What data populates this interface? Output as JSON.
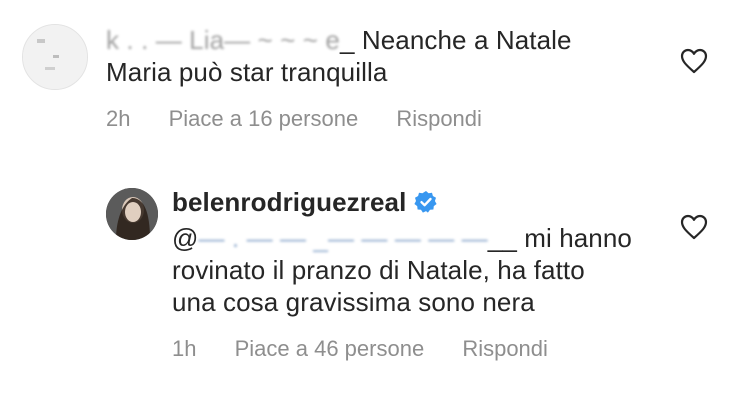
{
  "comment1": {
    "username_masked": "k  . . — Lia— ~ ~  ~ e",
    "username_tail": "_",
    "text_line1": "Neanche a Natale",
    "text_line2": "Maria può star tranquilla",
    "time": "2h",
    "likes": "Piace a 16 persone",
    "reply": "Rispondi"
  },
  "comment2": {
    "username": "belenrodriguezreal",
    "mention_prefix": "@",
    "mention_masked": "— . — — _— — — — —",
    "mention_tail": "__",
    "text_line1": "mi hanno",
    "text_line2": "rovinato il pranzo di Natale, ha fatto",
    "text_line3": "una cosa gravissima sono nera",
    "time": "1h",
    "likes": "Piace a 46 persone",
    "reply": "Rispondi"
  }
}
